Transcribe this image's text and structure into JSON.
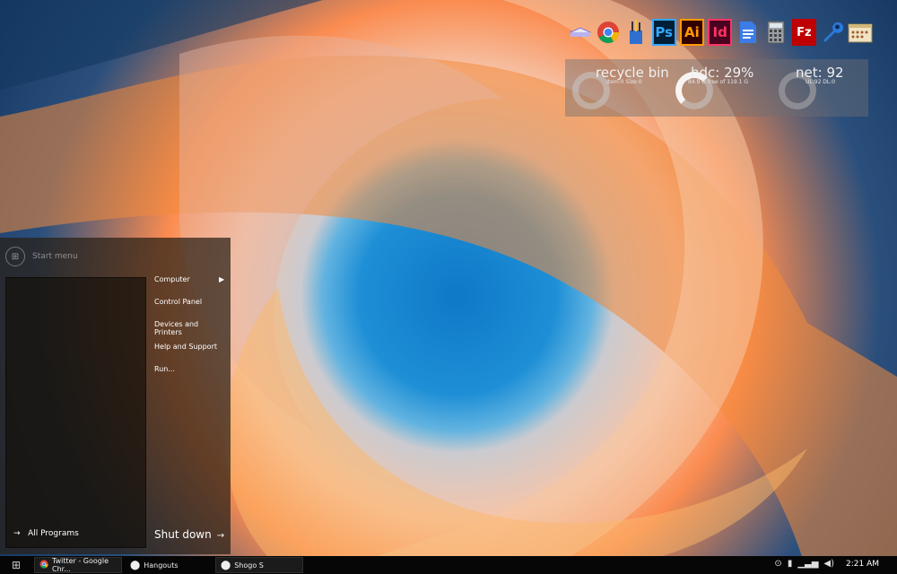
{
  "desktop": {
    "icons": [
      {
        "name": "drive-icon",
        "glyph": "▰"
      },
      {
        "name": "chrome-icon",
        "glyph": ""
      },
      {
        "name": "paint-brushes-icon",
        "glyph": "✎"
      },
      {
        "name": "photoshop-icon",
        "label": "Ps"
      },
      {
        "name": "illustrator-icon",
        "label": "Ai"
      },
      {
        "name": "indesign-icon",
        "label": "Id"
      },
      {
        "name": "document-icon",
        "glyph": "≣"
      },
      {
        "name": "calculator-icon",
        "glyph": "▦"
      },
      {
        "name": "filezilla-icon",
        "label": "Fz"
      },
      {
        "name": "wrench-icon",
        "glyph": "🔧"
      },
      {
        "name": "archive-icon",
        "glyph": "▤"
      }
    ]
  },
  "widgets": {
    "recycle": {
      "title": "recycle bin",
      "sub": "Item:0 Size:0"
    },
    "hdc": {
      "title": "hdc: 29%",
      "sub": "84.9 G free of 119.1 G"
    },
    "net": {
      "title": "net: 92",
      "sub": "UL:92 DL:0"
    }
  },
  "start_menu": {
    "title": "Start menu",
    "all_programs": "All Programs",
    "links": [
      "Computer",
      "Control Panel",
      "Devices and Printers",
      "Help and Support",
      "Run..."
    ],
    "shutdown": "Shut down"
  },
  "taskbar": {
    "tasks": [
      {
        "label": "Twitter - Google Chr..."
      },
      {
        "label": "Hangouts"
      },
      {
        "label": "Shogo S"
      }
    ],
    "clock": "2:21 AM"
  },
  "colors": {
    "taskbar": "#060606",
    "start_menu": "#281f16",
    "wallpaper_blue": "#1e8fd6",
    "wallpaper_orange": "#fa7832"
  }
}
